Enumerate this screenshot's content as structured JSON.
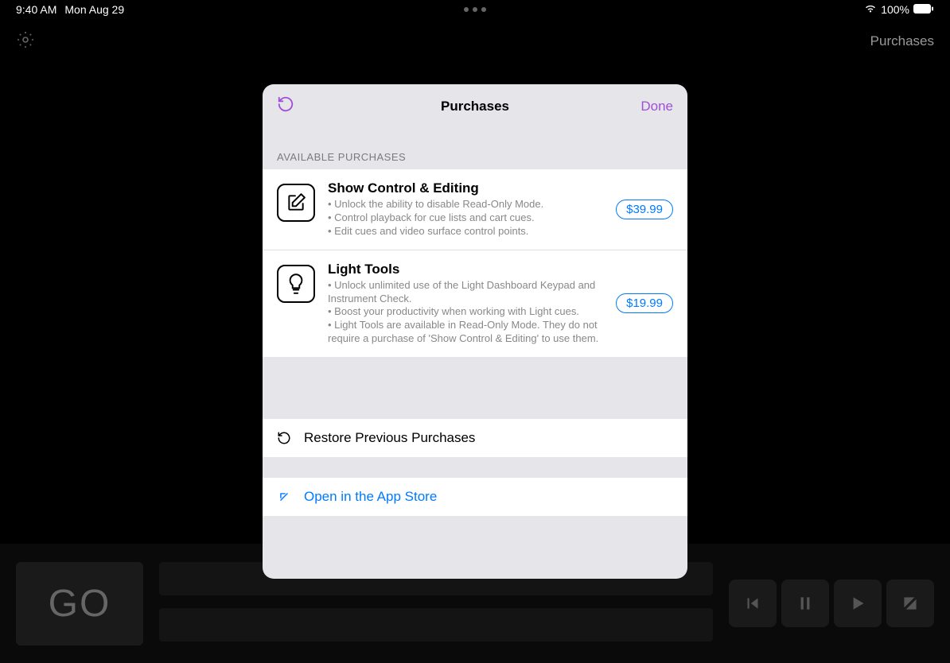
{
  "statusbar": {
    "time": "9:40 AM",
    "date": "Mon Aug 29",
    "battery": "100%"
  },
  "nav": {
    "title": "Purchases"
  },
  "modal": {
    "title": "Purchases",
    "done": "Done",
    "section_header": "AVAILABLE PURCHASES",
    "items": [
      {
        "title": "Show Control & Editing",
        "bullets": [
          "Unlock the ability to disable Read-Only Mode.",
          "Control playback for cue lists and cart cues.",
          "Edit cues and video surface control points."
        ],
        "price": "$39.99"
      },
      {
        "title": "Light Tools",
        "bullets": [
          "Unlock unlimited use of the Light Dashboard Keypad and Instrument Check.",
          "Boost your productivity when working with Light cues.",
          "Light Tools are available in Read-Only Mode. They do not require a purchase of 'Show Control & Editing' to use them."
        ],
        "price": "$19.99"
      }
    ],
    "restore": "Restore Previous Purchases",
    "appstore": "Open in the App Store"
  },
  "bottom": {
    "go": "GO"
  }
}
